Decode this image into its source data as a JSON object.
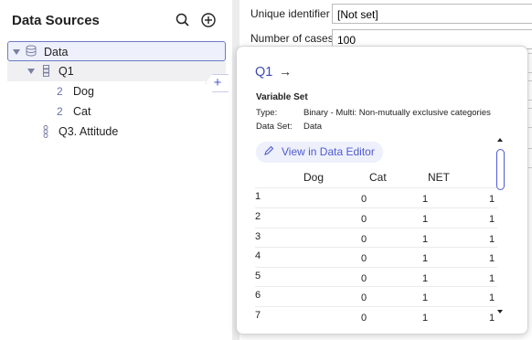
{
  "sidebar": {
    "title": "Data Sources",
    "items": [
      {
        "label": "Data"
      },
      {
        "label": "Q1"
      },
      {
        "label": "Dog",
        "icon_text": "2"
      },
      {
        "label": "Cat",
        "icon_text": "2"
      },
      {
        "label": "Q3. Attitude"
      }
    ],
    "add_tab_label": "+"
  },
  "properties": {
    "unique_identifier_label": "Unique identifier",
    "unique_identifier_value": "[Not set]",
    "number_of_cases_label": "Number of cases",
    "number_of_cases_value": "100"
  },
  "popup": {
    "title": "Q1",
    "arrow": "→",
    "heading": "Variable Set",
    "type_label": "Type:",
    "type_value": "Binary - Multi: Non-mutually exclusive categories",
    "dataset_label": "Data Set:",
    "dataset_value": "Data",
    "view_button_label": "View in Data Editor",
    "table": {
      "columns": [
        "Dog",
        "Cat",
        "NET"
      ],
      "rows": [
        {
          "id": "1",
          "dog": "0",
          "cat": "1",
          "net": "1"
        },
        {
          "id": "2",
          "dog": "0",
          "cat": "1",
          "net": "1"
        },
        {
          "id": "3",
          "dog": "0",
          "cat": "1",
          "net": "1"
        },
        {
          "id": "4",
          "dog": "0",
          "cat": "1",
          "net": "1"
        },
        {
          "id": "5",
          "dog": "0",
          "cat": "1",
          "net": "1"
        },
        {
          "id": "6",
          "dog": "0",
          "cat": "1",
          "net": "1"
        },
        {
          "id": "7",
          "dog": "0",
          "cat": "1",
          "net": "1"
        }
      ]
    }
  },
  "colors": {
    "accent": "#4e5bd1",
    "selection_border": "#6d7bc5"
  }
}
